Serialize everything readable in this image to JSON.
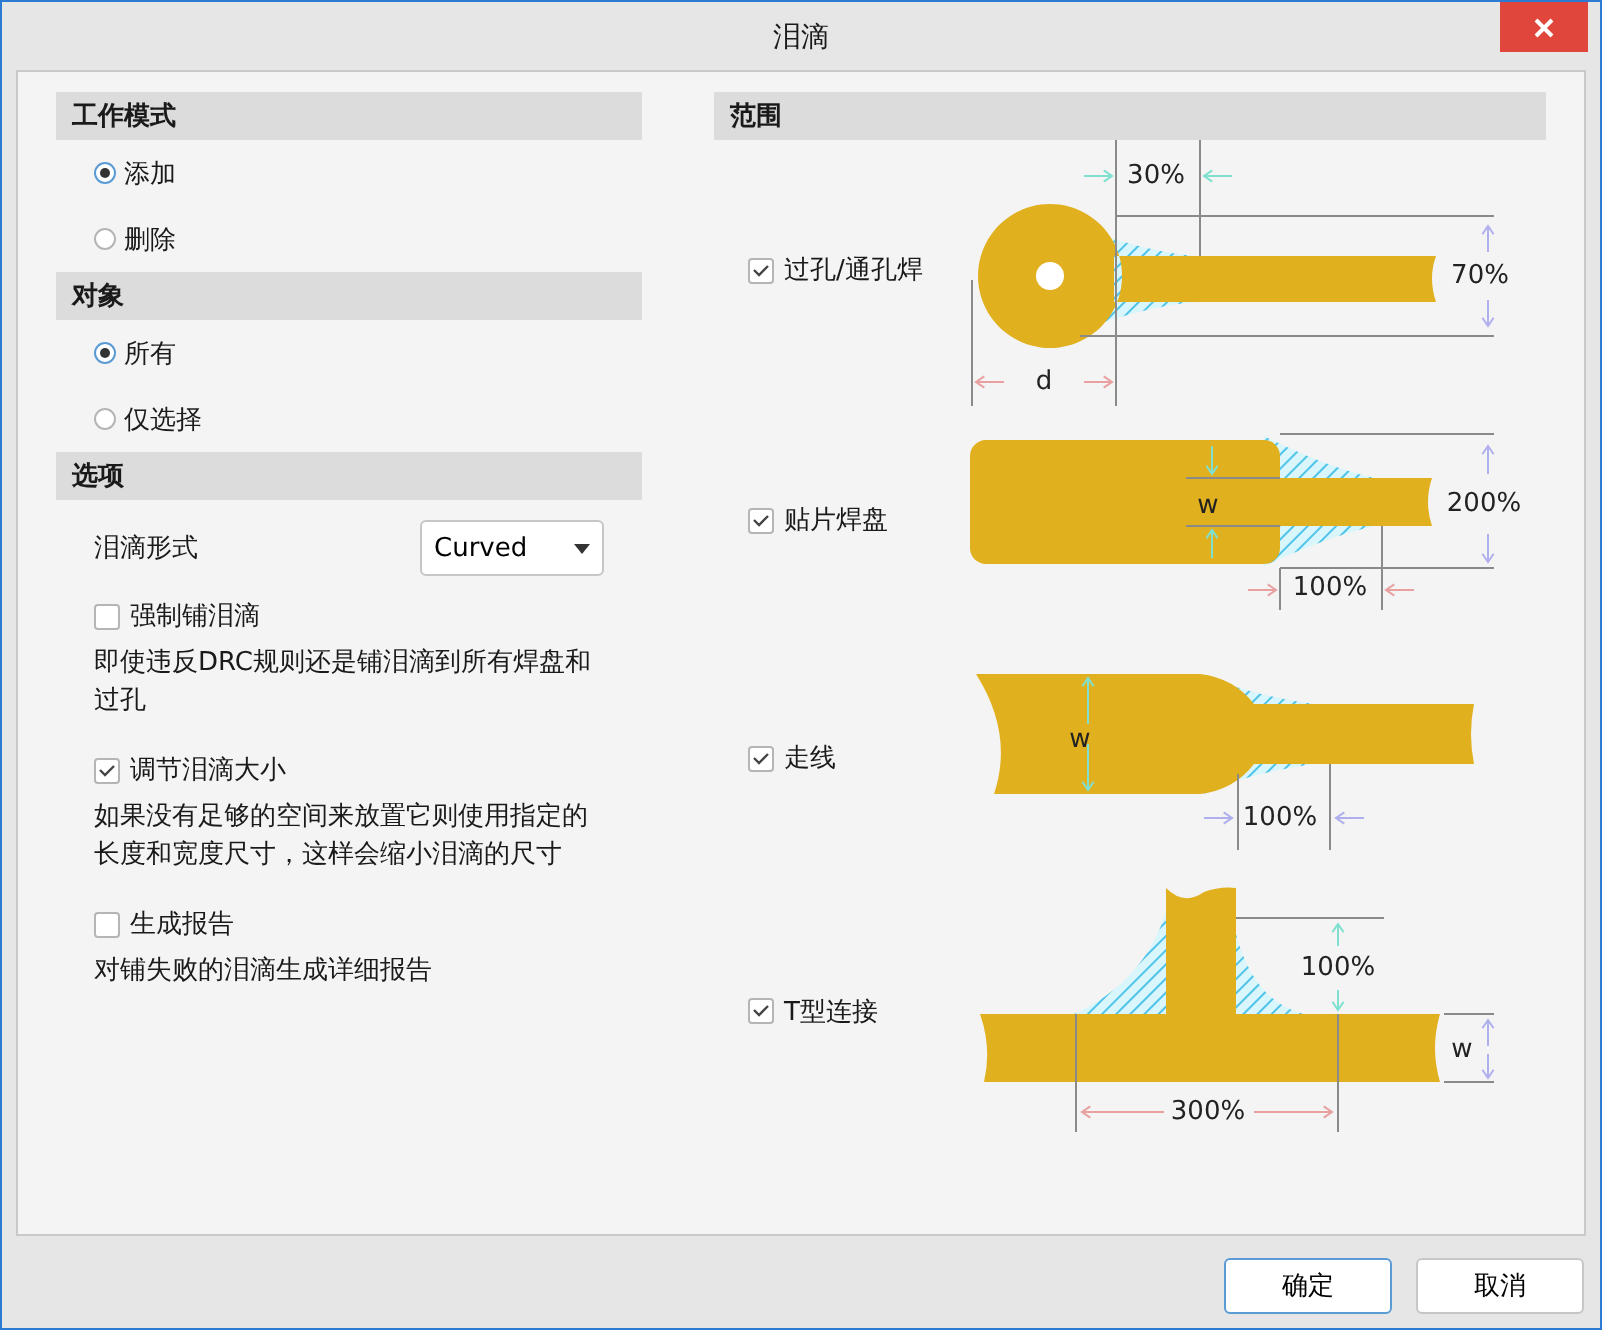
{
  "window": {
    "title": "泪滴"
  },
  "left_sections": [
    {
      "title": "工作模式",
      "items": [
        {
          "kind": "radio",
          "label": "添加",
          "selected": true
        },
        {
          "kind": "radio",
          "label": "删除",
          "selected": false
        }
      ]
    },
    {
      "title": "对象",
      "items": [
        {
          "kind": "radio",
          "label": "所有",
          "selected": true
        },
        {
          "kind": "radio",
          "label": "仅选择",
          "selected": false
        }
      ]
    },
    {
      "title": "选项",
      "items": [
        {
          "kind": "select",
          "label": "泪滴形式",
          "value": "Curved"
        },
        {
          "kind": "checkbox",
          "label": "强制铺泪滴",
          "checked": false,
          "note": "即使违反DRC规则还是铺泪滴到所有焊盘和过孔"
        },
        {
          "kind": "checkbox",
          "label": "调节泪滴大小",
          "checked": true,
          "note": "如果没有足够的空间来放置它则使用指定的长度和宽度尺寸，这样会缩小泪滴的尺寸"
        },
        {
          "kind": "checkbox",
          "label": "生成报告",
          "checked": false,
          "note": "对铺失败的泪滴生成详细报告"
        }
      ]
    }
  ],
  "scope": {
    "title": "范围",
    "items": [
      {
        "kind": "via",
        "label": "过孔/通孔焊",
        "checked": true,
        "dims": [
          "30%",
          "70%",
          "d"
        ]
      },
      {
        "kind": "smd",
        "label": "贴片焊盘",
        "checked": true,
        "dims": [
          "w",
          "200%",
          "100%"
        ]
      },
      {
        "kind": "track",
        "label": "走线",
        "checked": true,
        "dims": [
          "w",
          "100%"
        ]
      },
      {
        "kind": "tee",
        "label": "T型连接",
        "checked": true,
        "dims": [
          "100%",
          "w",
          "300%"
        ]
      }
    ]
  },
  "buttons": [
    {
      "label": "确定",
      "default": true
    },
    {
      "label": "取消",
      "default": false
    }
  ]
}
